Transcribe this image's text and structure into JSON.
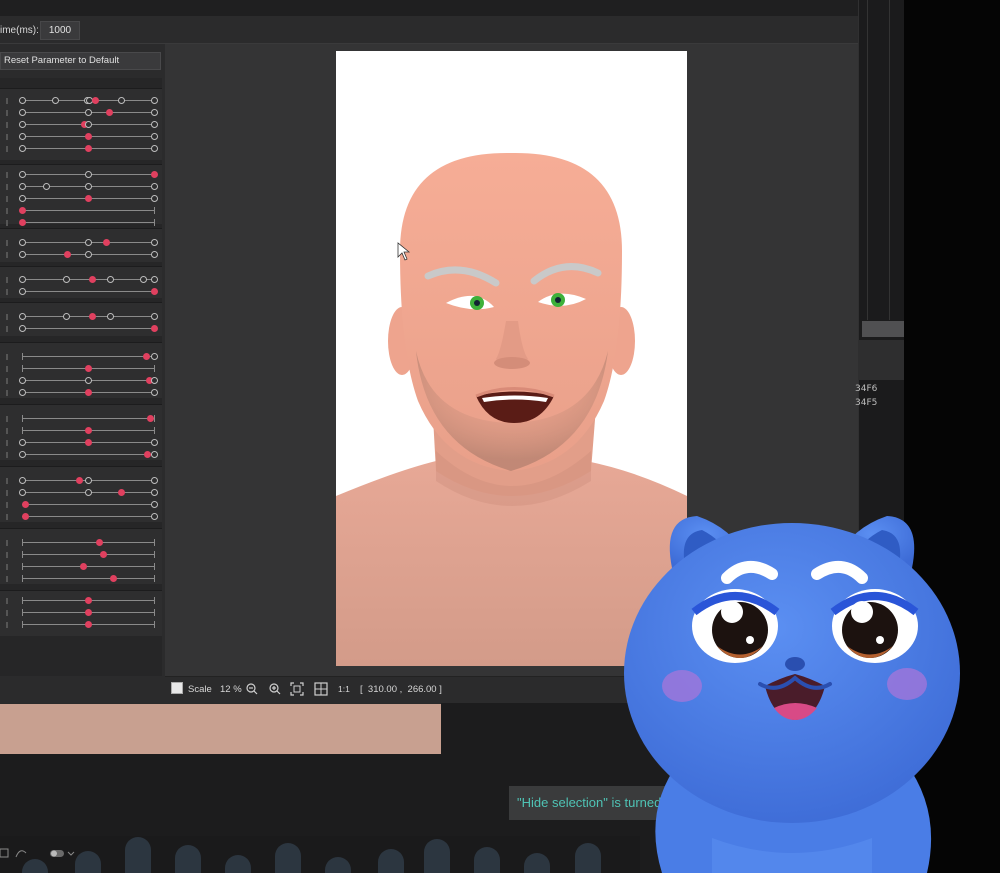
{
  "app": {
    "time_label": "ime(ms):",
    "time_value": "1000",
    "reset_button_label": "Reset Parameter to Default"
  },
  "status_bar": {
    "scale_label": "Scale",
    "scale_value": "12 %",
    "one_to_one_label": "1:1",
    "coordinates": "[  310.00 ,  266.00 ]"
  },
  "right_panel": {
    "hex_labels": [
      "34F6",
      "34F5"
    ]
  },
  "toast": {
    "message": "\"Hide selection\" is turned o"
  },
  "colors": {
    "accent_handle": "#e0405f",
    "toast_text": "#4fc3b5",
    "skin": "#f4ab94",
    "eye": "#3db03a",
    "mascot_blue": "#4b7fe8"
  },
  "icons": [
    "zoom-out-icon",
    "zoom-in-icon",
    "fit-to-window-icon",
    "fit-to-frame-icon",
    "mouse-cursor-icon"
  ]
}
